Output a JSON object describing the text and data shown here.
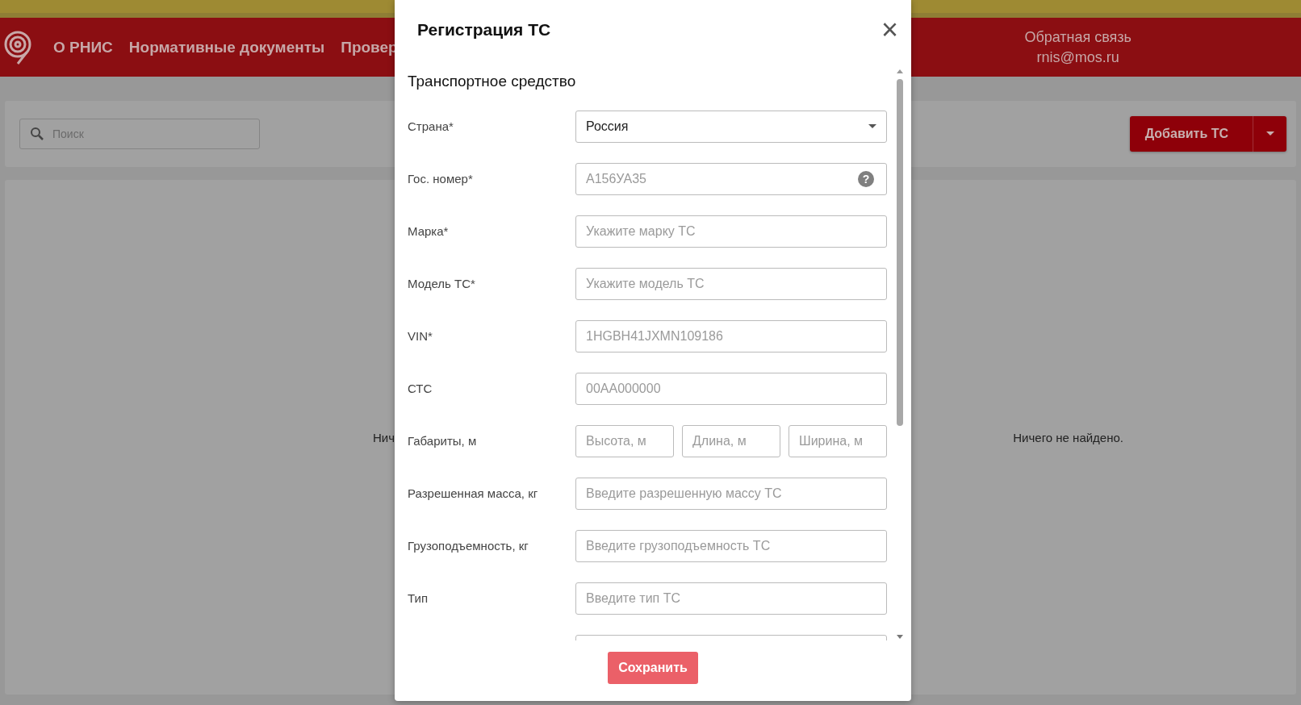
{
  "header": {
    "nav": [
      "О РНИС",
      "Нормативные документы",
      "Провер"
    ],
    "feedback": {
      "title": "Обратная связь",
      "email": "rnis@mos.ru"
    }
  },
  "toolbar": {
    "search": {
      "placeholder": "Поиск"
    },
    "add_button": "Добавить ТС"
  },
  "content": {
    "empty_left": "Нич",
    "empty_right": "Ничего не найдено."
  },
  "modal": {
    "title": "Регистрация ТС",
    "close": "×",
    "section": "Транспортное средство",
    "fields": [
      {
        "kind": "select",
        "label": "Страна*",
        "value": "Россия"
      },
      {
        "kind": "help",
        "label": "Гос. номер*",
        "placeholder": "А156УА35",
        "help": "?"
      },
      {
        "kind": "input",
        "label": "Марка*",
        "placeholder": "Укажите марку ТС"
      },
      {
        "kind": "input",
        "label": "Модель ТС*",
        "placeholder": "Укажите модель ТС"
      },
      {
        "kind": "input",
        "label": "VIN*",
        "placeholder": "1HGBH41JXMN109186"
      },
      {
        "kind": "input",
        "label": "СТС",
        "placeholder": "00АА000000"
      },
      {
        "kind": "triple",
        "label": "Габариты, м",
        "placeholders": [
          "Высота, м",
          "Длина, м",
          "Ширина, м"
        ]
      },
      {
        "kind": "input",
        "label": "Разрешенная масса, кг",
        "placeholder": "Введите разрешенную массу ТС"
      },
      {
        "kind": "input",
        "label": "Грузоподъемность, кг",
        "placeholder": "Введите грузоподъемность ТС"
      },
      {
        "kind": "input",
        "label": "Тип",
        "placeholder": "Введите тип ТС"
      },
      {
        "kind": "input"
      }
    ],
    "save_button": "Сохранить"
  }
}
